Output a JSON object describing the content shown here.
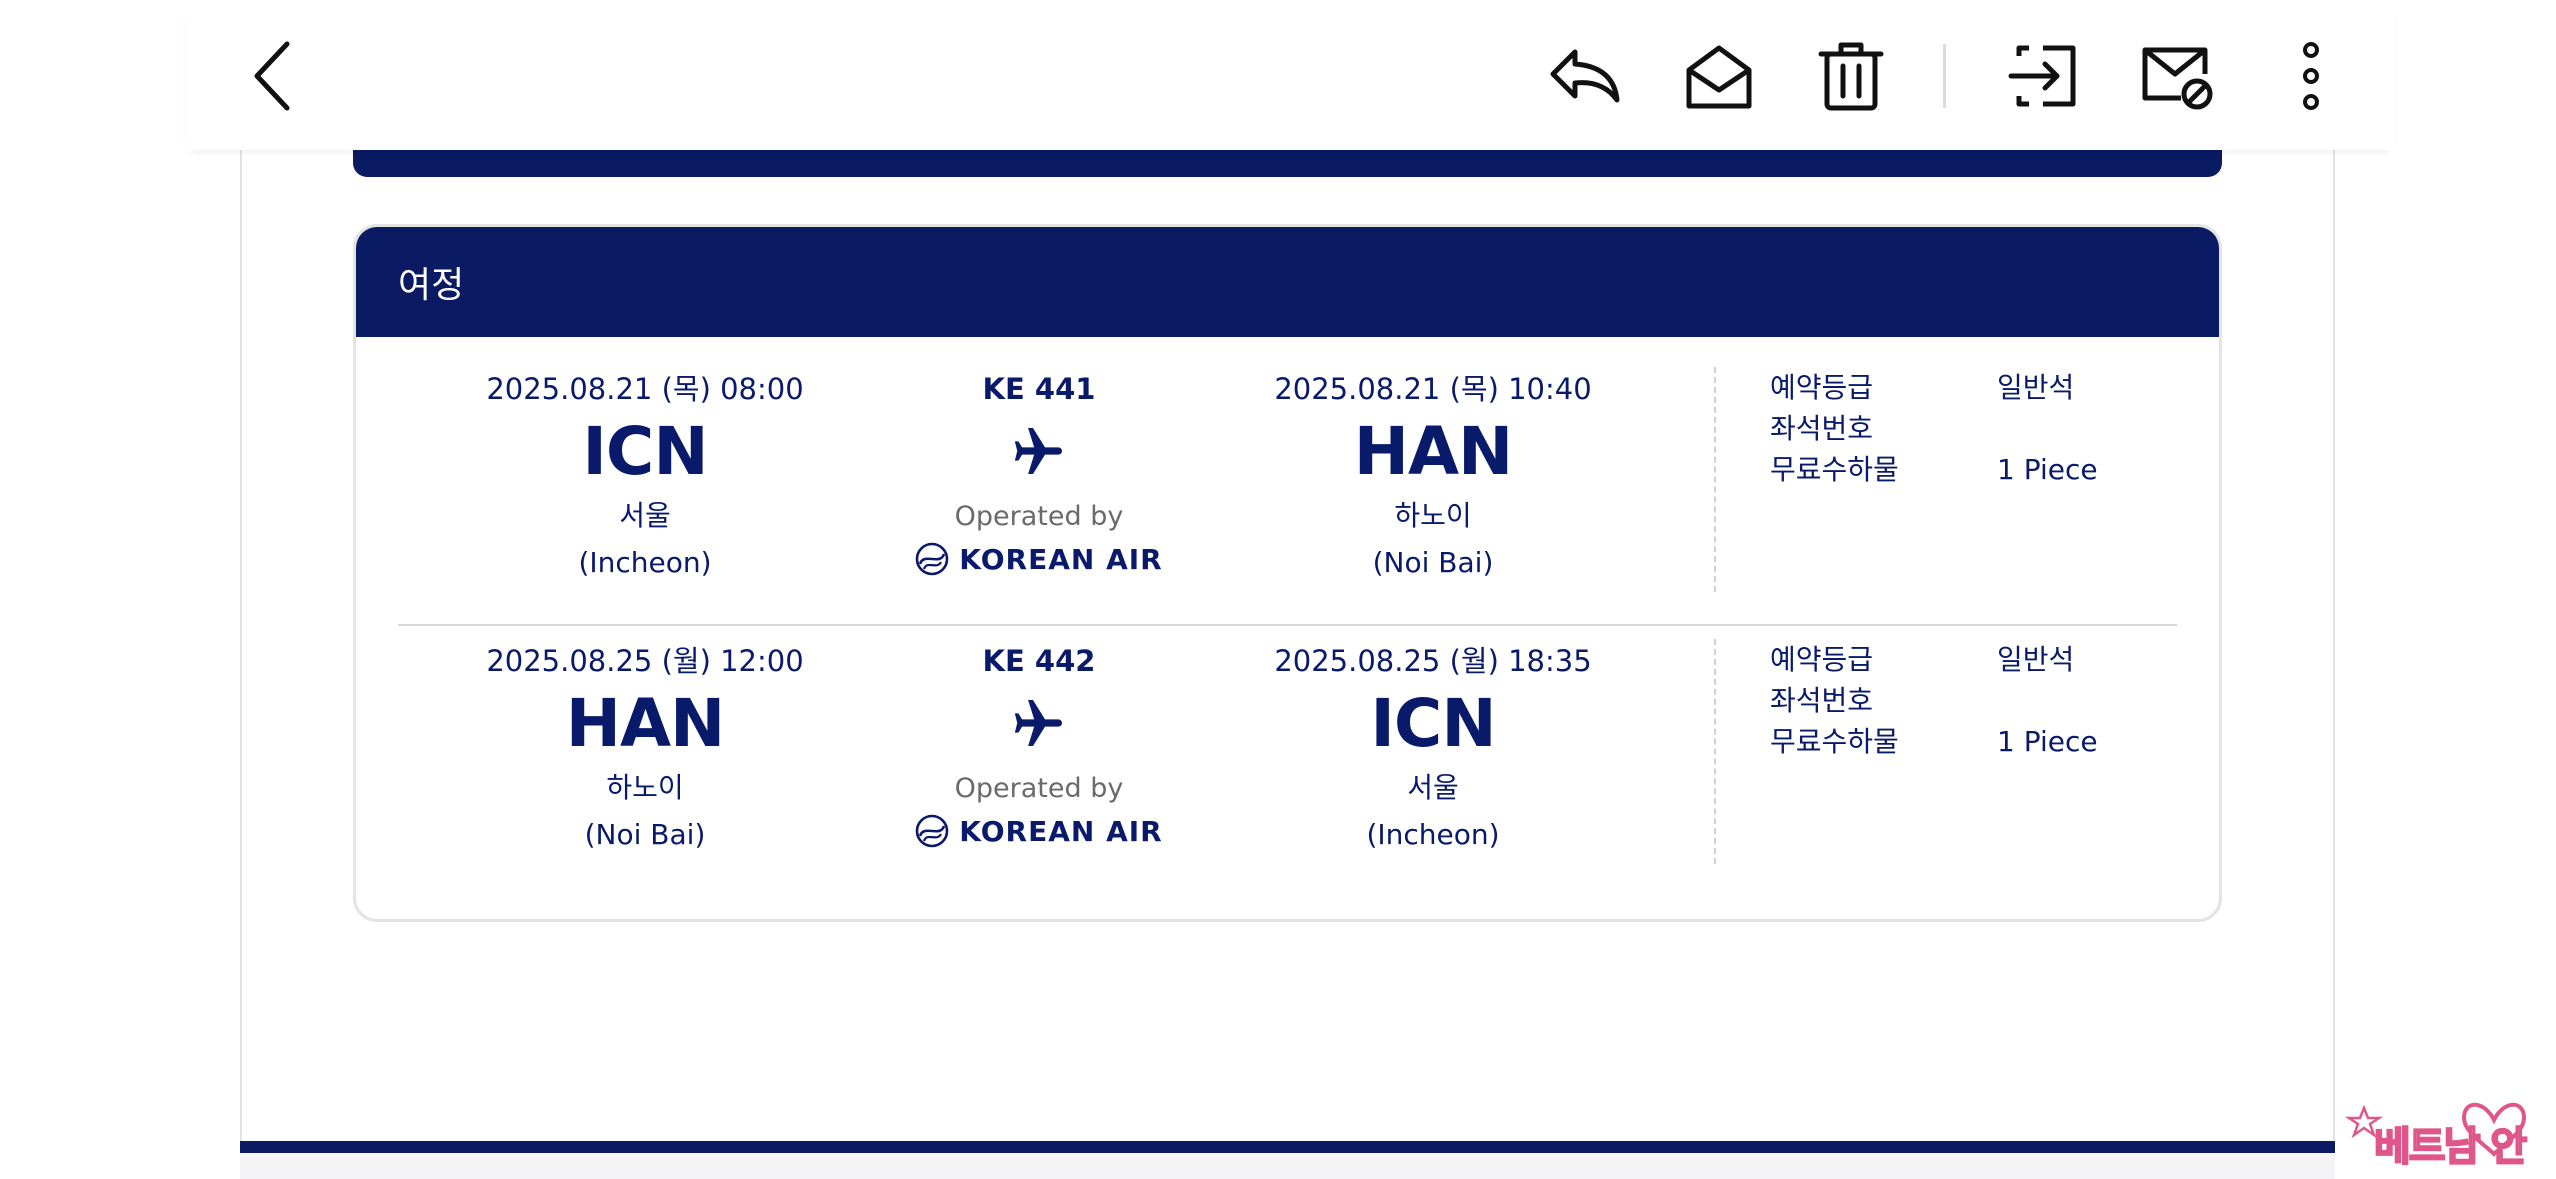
{
  "toolbar": {
    "icons": [
      "chevron-left-icon",
      "reply-icon",
      "envelope-open-icon",
      "trash-icon",
      "move-to-icon",
      "block-mail-icon",
      "more-vertical-icon"
    ]
  },
  "itinerary": {
    "title": "여정",
    "segments": [
      {
        "departure": {
          "datetime": "2025.08.21 (목) 08:00",
          "code": "ICN",
          "city": "서울",
          "airport": "(Incheon)"
        },
        "flight": {
          "number": "KE 441",
          "operated_by": "Operated by",
          "carrier": "KOREAN AIR"
        },
        "arrival": {
          "datetime": "2025.08.21 (목) 10:40",
          "code": "HAN",
          "city": "하노이",
          "airport": "(Noi Bai)"
        },
        "details": {
          "class_label": "예약등급",
          "class_value": "일반석",
          "seat_label": "좌석번호",
          "seat_value": "",
          "baggage_label": "무료수하물",
          "baggage_value": "1 Piece"
        }
      },
      {
        "departure": {
          "datetime": "2025.08.25 (월) 12:00",
          "code": "HAN",
          "city": "하노이",
          "airport": "(Noi Bai)"
        },
        "flight": {
          "number": "KE 442",
          "operated_by": "Operated by",
          "carrier": "KOREAN AIR"
        },
        "arrival": {
          "datetime": "2025.08.25 (월) 18:35",
          "code": "ICN",
          "city": "서울",
          "airport": "(Incheon)"
        },
        "details": {
          "class_label": "예약등급",
          "class_value": "일반석",
          "seat_label": "좌석번호",
          "seat_value": "",
          "baggage_label": "무료수하물",
          "baggage_value": "1 Piece"
        }
      }
    ]
  },
  "watermark": {
    "text": "베트남 안방"
  },
  "colors": {
    "navy": "#0a1a63",
    "text": "#0a1a6b",
    "muted": "#6a6a6a",
    "border": "#e4e4e4",
    "watermark_pink": "#e0568a"
  }
}
